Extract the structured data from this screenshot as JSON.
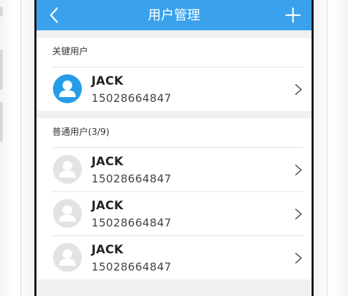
{
  "header": {
    "title": "用户管理",
    "back_icon": "chevron-left-icon",
    "add_icon": "plus-icon",
    "color": "#3aa2ec"
  },
  "key_section": {
    "title": "关键用户",
    "users": [
      {
        "name": "JACK",
        "phone": "15028664847",
        "avatar_icon": "user-avatar-icon",
        "avatar_color": "#259de8"
      }
    ]
  },
  "normal_section": {
    "title": "普通用户(3/9)",
    "users": [
      {
        "name": "JACK",
        "phone": "15028664847",
        "avatar_icon": "user-avatar-icon",
        "avatar_color": "#e3e3e3"
      },
      {
        "name": "JACK",
        "phone": "15028664847",
        "avatar_icon": "user-avatar-icon",
        "avatar_color": "#e3e3e3"
      },
      {
        "name": "JACK",
        "phone": "15028664847",
        "avatar_icon": "user-avatar-icon",
        "avatar_color": "#e3e3e3"
      }
    ]
  }
}
